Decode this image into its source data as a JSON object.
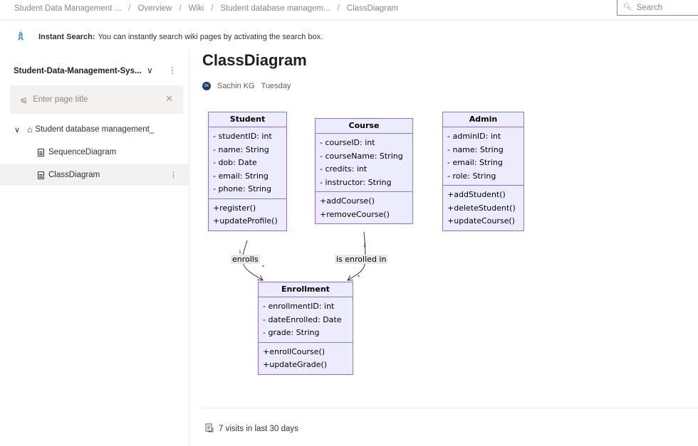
{
  "breadcrumbs": [
    "Student Data Management ...",
    "Overview",
    "Wiki",
    "Student database managem...",
    "ClassDiagram"
  ],
  "search": {
    "placeholder": "Search",
    "icon": "search-icon"
  },
  "banner": {
    "title": "Instant Search:",
    "text": "You can instantly search wiki pages by activating the search box.",
    "icon": "rocket-icon"
  },
  "sidebar": {
    "wiki_name": "Student-Data-Management-Sys...",
    "filter_placeholder": "Enter page title",
    "tree": {
      "root": "Student database management_",
      "items": [
        {
          "label": "SequenceDiagram",
          "selected": false
        },
        {
          "label": "ClassDiagram",
          "selected": true
        }
      ]
    }
  },
  "page": {
    "title": "ClassDiagram",
    "author_initials": "SK",
    "author": "Sachin KG",
    "date": "Tuesday",
    "visits": "7 visits in last 30 days"
  },
  "diagram": {
    "classes": {
      "student": {
        "name": "Student",
        "attributes": [
          "- studentID: int",
          "- name: String",
          "- dob: Date",
          "- email: String",
          "- phone: String"
        ],
        "methods": [
          "+register()",
          "+updateProfile()"
        ]
      },
      "course": {
        "name": "Course",
        "attributes": [
          "- courseID: int",
          "- courseName: String",
          "- credits: int",
          "- instructor: String"
        ],
        "methods": [
          "+addCourse()",
          "+removeCourse()"
        ]
      },
      "admin": {
        "name": "Admin",
        "attributes": [
          "- adminID: int",
          "- name: String",
          "- email: String",
          "- role: String"
        ],
        "methods": [
          "+addStudent()",
          "+deleteStudent()",
          "+updateCourse()"
        ]
      },
      "enrollment": {
        "name": "Enrollment",
        "attributes": [
          "- enrollmentID: int",
          "- dateEnrolled: Date",
          "- grade: String"
        ],
        "methods": [
          "+enrollCourse()",
          "+updateGrade()"
        ]
      }
    },
    "relations": [
      {
        "from": "Student",
        "to": "Enrollment",
        "label": "enrolls",
        "from_card": "1",
        "to_card": "*"
      },
      {
        "from": "Course",
        "to": "Enrollment",
        "label": "is enrolled in",
        "from_card": "1",
        "to_card": "*"
      }
    ],
    "colors": {
      "fill": "#ececff",
      "border": "#9370db",
      "edge": "#333333"
    }
  }
}
